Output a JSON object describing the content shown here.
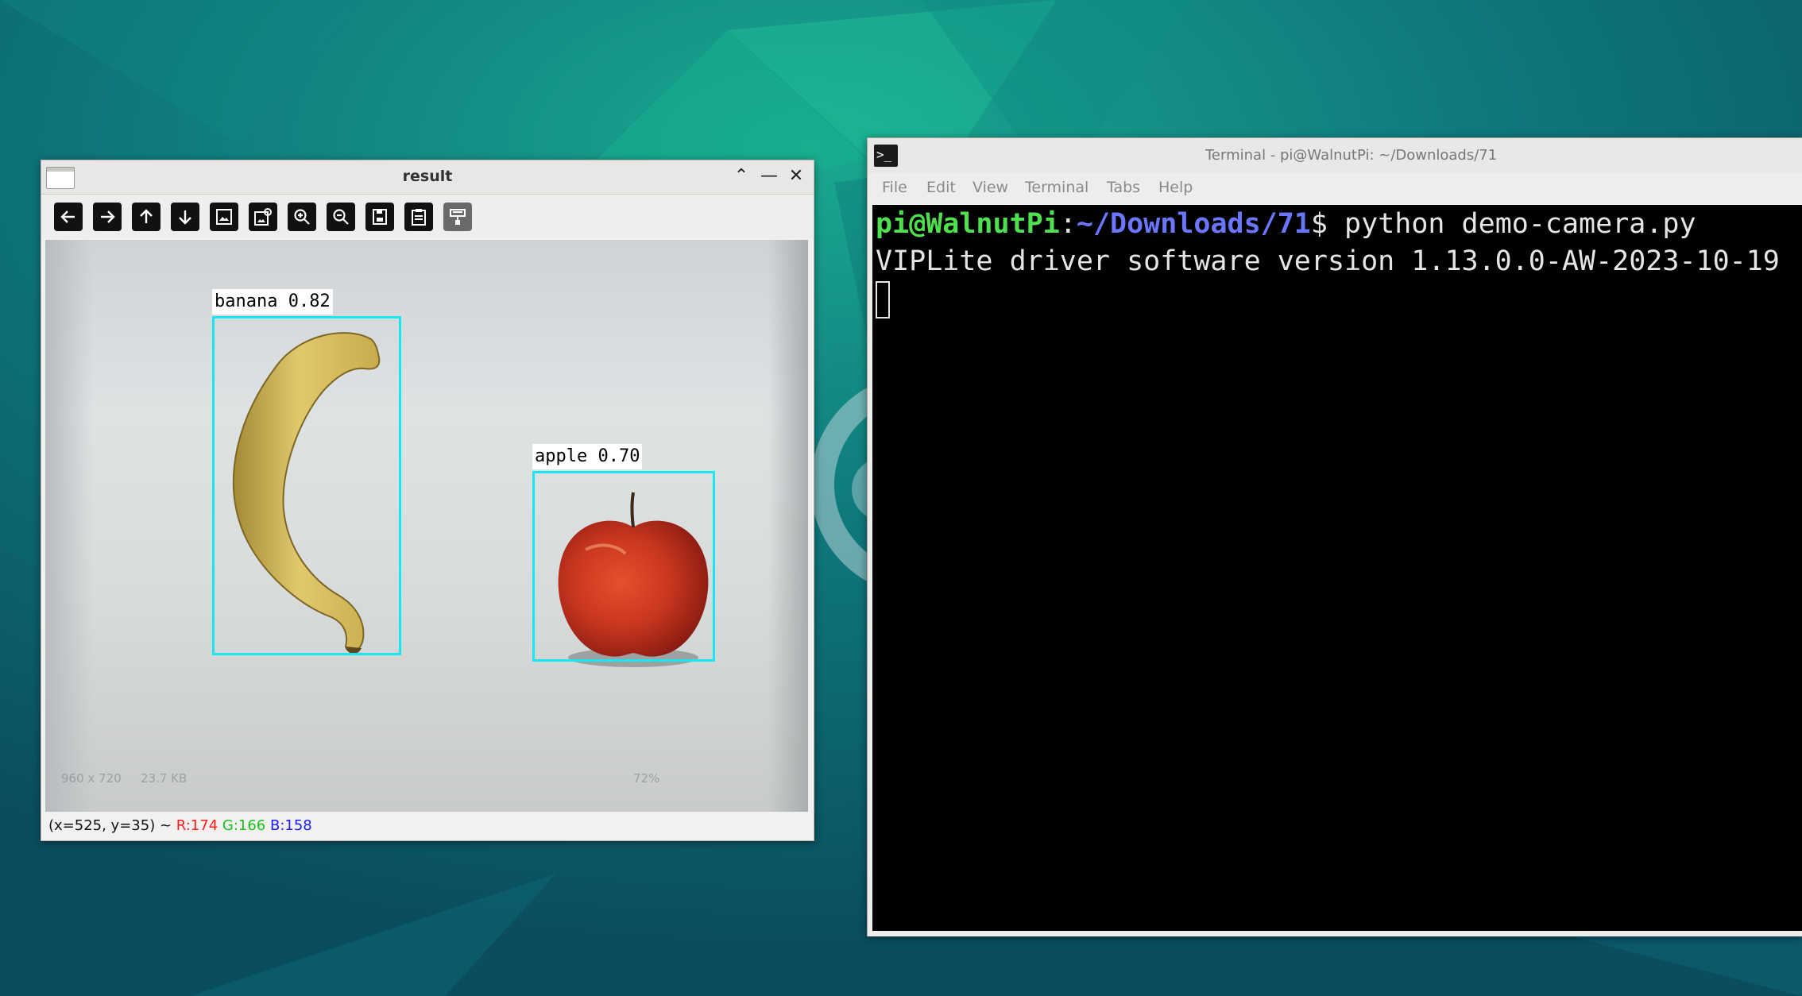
{
  "result_window": {
    "title": "result",
    "controls": {
      "maximize": "⌃",
      "minimize": "—",
      "close": "✕"
    },
    "toolbar_icons": [
      "arrow-left-icon",
      "arrow-right-icon",
      "arrow-up-icon",
      "arrow-down-icon",
      "image-icon",
      "image-settings-icon",
      "zoom-in-icon",
      "zoom-out-icon",
      "save-icon",
      "clipboard-icon",
      "properties-icon"
    ],
    "detections": [
      {
        "label": "banana 0.82"
      },
      {
        "label": "apple 0.70"
      }
    ],
    "faint_overlay": {
      "size_text": "960 x 720",
      "file_size": "23.7 KB",
      "zoom": "72%"
    },
    "status": {
      "coords": "(x=525, y=35) ~",
      "r": "R:174",
      "g": "G:166",
      "b": "B:158",
      "r_color": "#ff1a1a",
      "g_color": "#19c219",
      "b_color": "#1a1aff"
    }
  },
  "terminal_window": {
    "title": "Terminal - pi@WalnutPi: ~/Downloads/71",
    "menu": [
      "File",
      "Edit",
      "View",
      "Terminal",
      "Tabs",
      "Help"
    ],
    "prompt_user": "pi@WalnutPi",
    "prompt_sep": ":",
    "prompt_path": "~/Downloads/71",
    "prompt_end": "$ ",
    "command": "python demo-camera.py",
    "output": "VIPLite driver software version 1.13.0.0-AW-2023-10-19"
  }
}
